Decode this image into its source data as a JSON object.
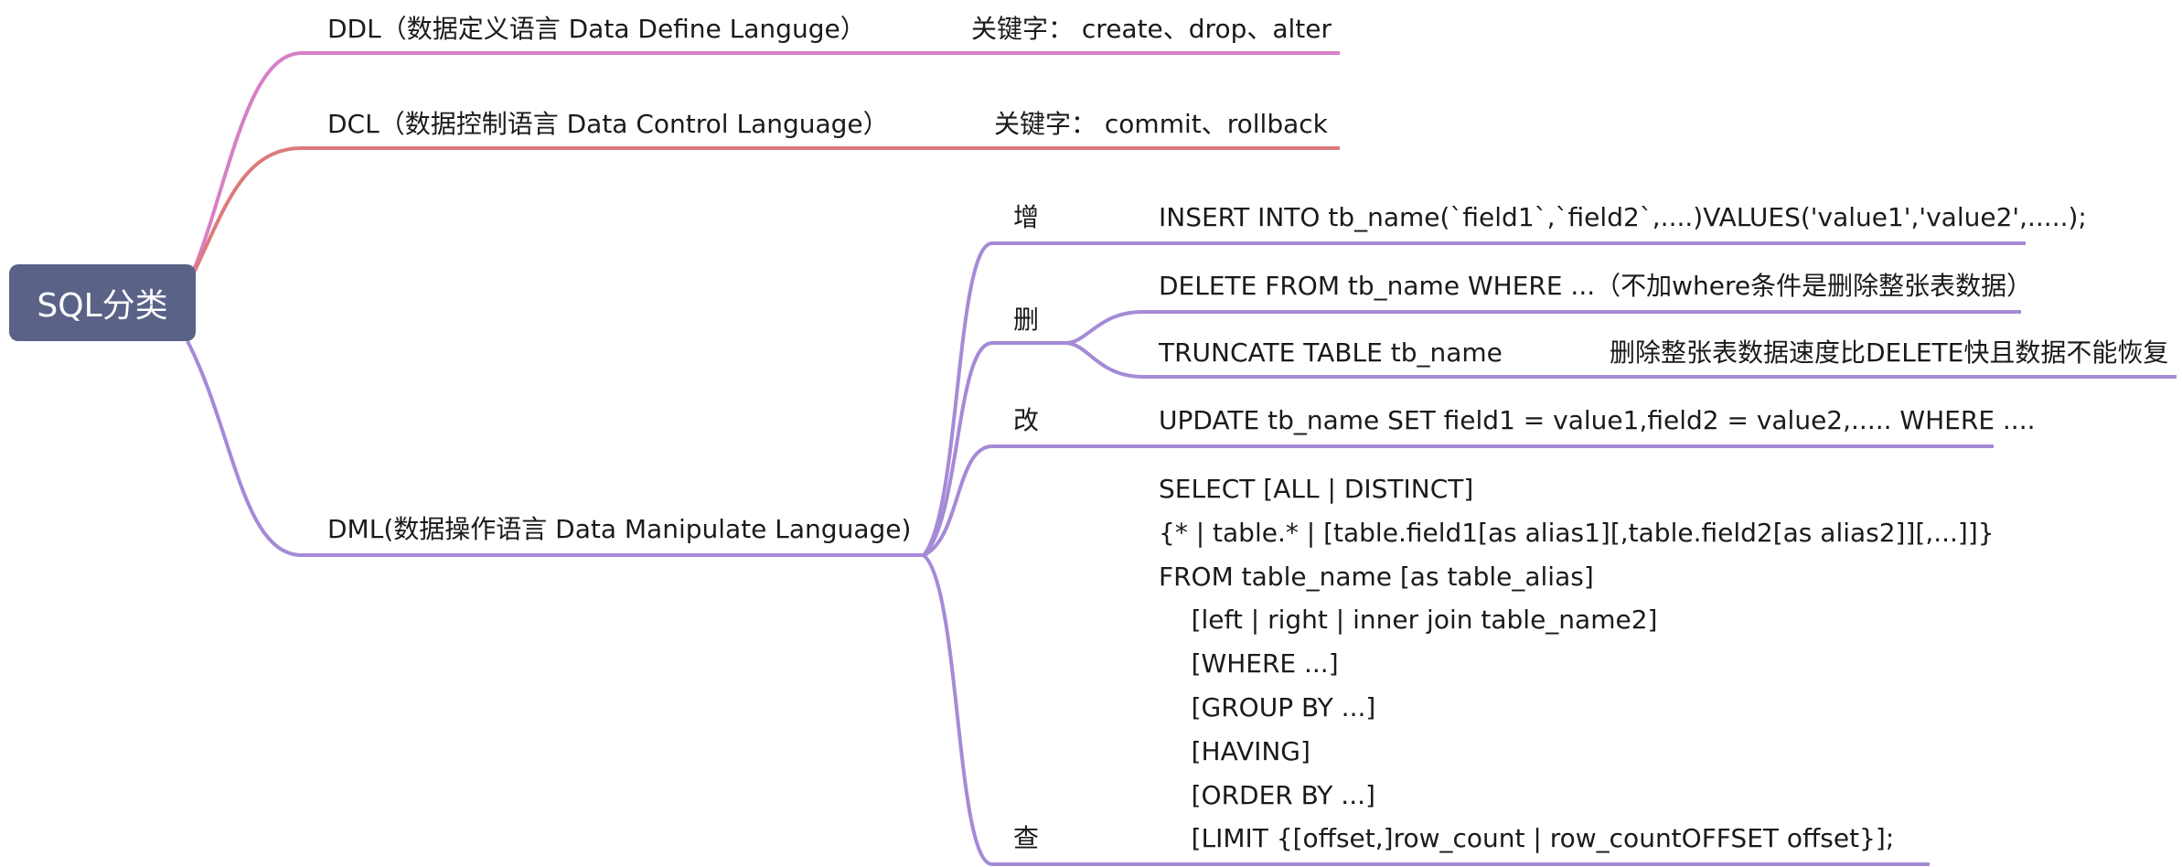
{
  "root": "SQL分类",
  "ddl": {
    "title": "DDL（数据定义语言 Data Define Languge）",
    "keywords": "关键字： create、drop、alter"
  },
  "dcl": {
    "title": "DCL（数据控制语言 Data Control Language）",
    "keywords": "关键字： commit、rollback"
  },
  "dml": {
    "title": "DML(数据操作语言 Data Manipulate Language)",
    "insert": {
      "label": "增",
      "sql": "INSERT INTO tb_name(`field1`,`field2`,....)VALUES('value1','value2',.....);"
    },
    "delete": {
      "label": "删",
      "delete_sql": "DELETE FROM tb_name WHERE ...（不加where条件是删除整张表数据）",
      "truncate_sql": "TRUNCATE TABLE tb_name",
      "truncate_note": "删除整张表数据速度比DELETE快且数据不能恢复"
    },
    "update": {
      "label": "改",
      "sql": "UPDATE tb_name SET field1 = value1,field2 = value2,..... WHERE ...."
    },
    "select": {
      "label": "查",
      "lines": [
        "SELECT [ALL | DISTINCT]",
        "{* | table.* | [table.field1[as alias1][,table.field2[as alias2]][,...]]}",
        "FROM table_name [as table_alias]",
        "    [left | right | inner join table_name2]",
        "    [WHERE ...]",
        "    [GROUP BY ...]",
        "    [HAVING]",
        "    [ORDER BY ...]",
        "    [LIMIT {[offset,]row_count | row_countOFFSET offset}];"
      ]
    }
  },
  "colors": {
    "root": "#5b6287",
    "ddl": "#d77fc6",
    "dcl": "#dc7b7b",
    "dml": "#a58ad6"
  }
}
